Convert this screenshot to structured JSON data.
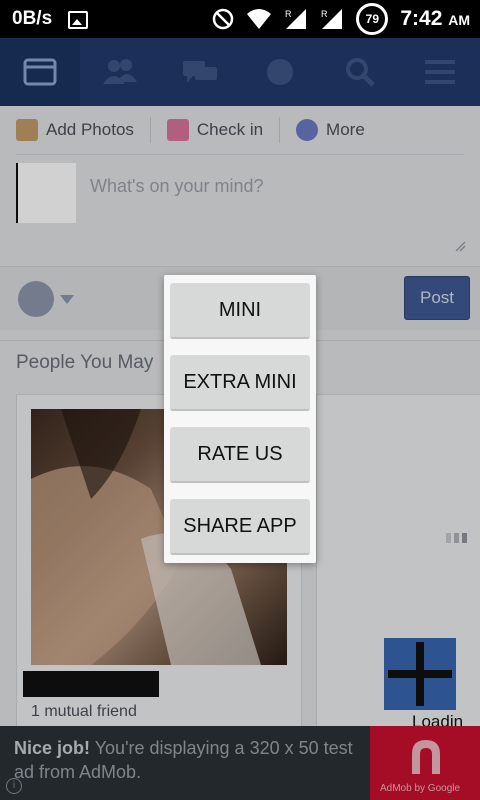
{
  "status_bar": {
    "speed": "0B/s",
    "battery": "79",
    "time": "7:42",
    "ampm": "AM"
  },
  "composer": {
    "add_photos": "Add Photos",
    "check_in": "Check in",
    "more": "More",
    "placeholder": "What's on your mind?",
    "post_label": "Post"
  },
  "feed": {
    "pymk_title": "People You May",
    "mutual_friends": "1 mutual friend",
    "loading": "Loadin"
  },
  "ad": {
    "bold": "Nice job!",
    "text": " You're displaying a 320 x 50 test ad from AdMob.",
    "brand": "AdMob by Google"
  },
  "menu": {
    "items": [
      "MINI",
      "EXTRA MINI",
      "RATE US",
      "SHARE APP"
    ]
  },
  "colors": {
    "nav_bg": "#223a6c",
    "accent": "#3d5a94",
    "ad_red": "#c8102e"
  }
}
